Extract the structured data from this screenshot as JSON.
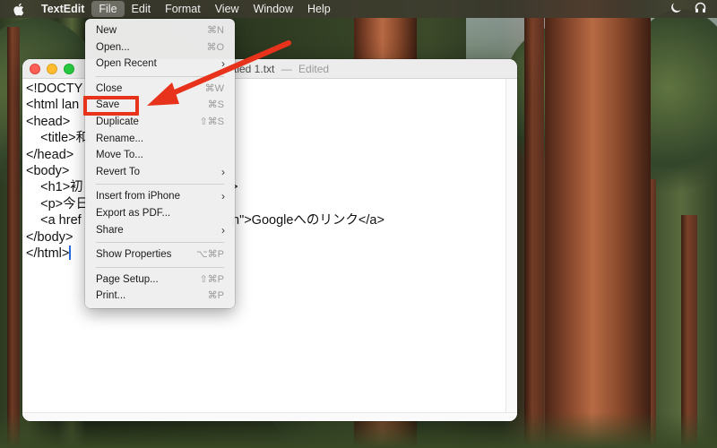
{
  "menubar": {
    "app_name": "TextEdit",
    "items": [
      "File",
      "Edit",
      "Format",
      "View",
      "Window",
      "Help"
    ],
    "active_item": "File"
  },
  "window": {
    "title": "Untitled 1.txt",
    "title_visible": "tled 1.txt",
    "separator": "—",
    "status": "Edited"
  },
  "editor": {
    "lines": [
      "<!DOCTY",
      "<html lan",
      "<head>",
      "    <title>和",
      "</head>",
      "<body>",
      "    <h1>初",
      "    <p>今日",
      "    <a href",
      "</body>",
      "</html>"
    ],
    "line_tails": [
      "",
      "",
      "",
      "",
      "",
      "",
      ">",
      "",
      "n\">Googleへのリンク</a>",
      "",
      ""
    ]
  },
  "file_menu": {
    "items": [
      {
        "label": "New",
        "shortcut": "⌘N"
      },
      {
        "label": "Open...",
        "shortcut": "⌘O"
      },
      {
        "label": "Open Recent",
        "submenu": "›"
      },
      {
        "separator": true
      },
      {
        "label": "Close",
        "shortcut": "⌘W"
      },
      {
        "label": "Save",
        "shortcut": "⌘S"
      },
      {
        "label": "Duplicate",
        "shortcut": "⇧⌘S"
      },
      {
        "label": "Rename..."
      },
      {
        "label": "Move To..."
      },
      {
        "label": "Revert To",
        "submenu": "›"
      },
      {
        "separator": true
      },
      {
        "label": "Insert from iPhone",
        "submenu": "›"
      },
      {
        "label": "Export as PDF..."
      },
      {
        "label": "Share",
        "submenu": "›"
      },
      {
        "separator": true
      },
      {
        "label": "Show Properties",
        "shortcut": "⌥⌘P"
      },
      {
        "separator": true
      },
      {
        "label": "Page Setup...",
        "shortcut": "⇧⌘P"
      },
      {
        "label": "Print...",
        "shortcut": "⌘P"
      }
    ]
  },
  "annotation": {
    "highlight_color": "#e8331c",
    "target": "Save"
  },
  "icons": {
    "apple": "apple-logo-icon",
    "moon": "moon-icon",
    "headphones": "headphones-icon"
  }
}
